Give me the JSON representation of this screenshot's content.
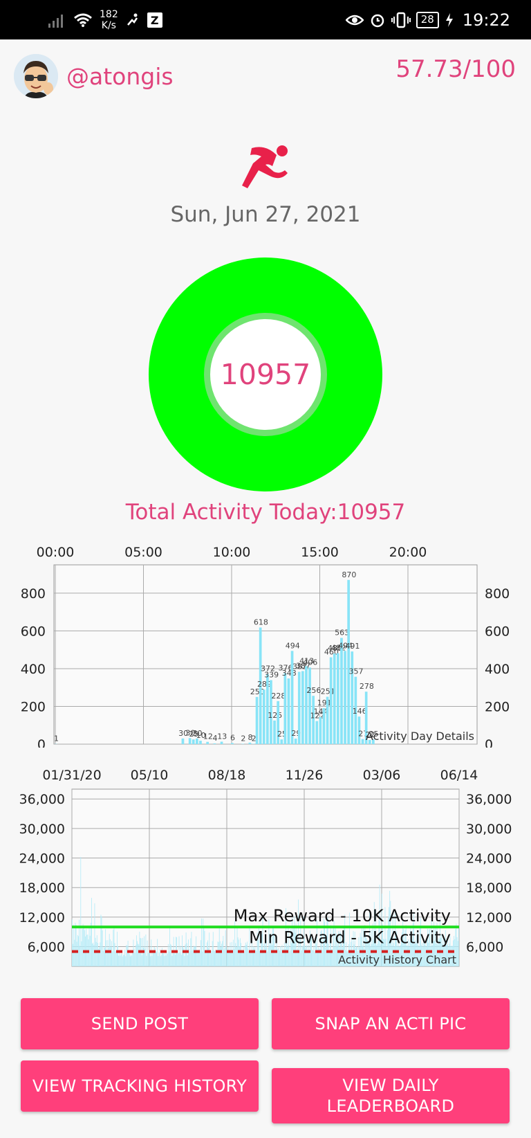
{
  "status_bar": {
    "speed_value": "182",
    "speed_unit": "K/s",
    "battery": "28",
    "time": "19:22"
  },
  "header": {
    "username": "@atongis",
    "score": "57.73/100"
  },
  "date": "Sun, Jun 27, 2021",
  "activity_ring": {
    "value": "10957",
    "progress": 1.0,
    "ring_color": "#00ff00",
    "inner_color": "#6fe46f"
  },
  "total_activity": "Total Activity Today:10957",
  "colors": {
    "accent": "#e0437c",
    "button": "#ff3f7b",
    "bar": "#88e4f7",
    "max_line": "#22dd22",
    "min_line": "#d42020"
  },
  "chart_data": [
    {
      "type": "bar",
      "caption": "Activity Day Details",
      "x_ticks": [
        "00:00",
        "05:00",
        "10:00",
        "15:00",
        "20:00"
      ],
      "ylim": [
        0,
        950
      ],
      "y_ticks": [
        "0",
        "200",
        "400",
        "600",
        "800"
      ],
      "values": [
        [
          0,
          1,
          "1"
        ],
        [
          36,
          30,
          "30"
        ],
        [
          38,
          32,
          "30"
        ],
        [
          39,
          25,
          "25"
        ],
        [
          40,
          30,
          "30"
        ],
        [
          41,
          18,
          "10"
        ],
        [
          43,
          12,
          "12"
        ],
        [
          45,
          4,
          "4"
        ],
        [
          47,
          13,
          "13"
        ],
        [
          50,
          6,
          "6"
        ],
        [
          53,
          2,
          "2"
        ],
        [
          55,
          8,
          "8"
        ],
        [
          56,
          2,
          "2"
        ],
        [
          57,
          250,
          "250"
        ],
        [
          58,
          618,
          "618"
        ],
        [
          59,
          289,
          "289"
        ],
        [
          60,
          372,
          "372"
        ],
        [
          61,
          339,
          "339"
        ],
        [
          62,
          125,
          "125"
        ],
        [
          63,
          228,
          "228"
        ],
        [
          64,
          25,
          "25"
        ],
        [
          65,
          376,
          "376"
        ],
        [
          66,
          348,
          "348"
        ],
        [
          67,
          494,
          "494"
        ],
        [
          68,
          29,
          "29"
        ],
        [
          69,
          383,
          "383"
        ],
        [
          70,
          387,
          "387"
        ],
        [
          71,
          413,
          "413"
        ],
        [
          72,
          406,
          "406"
        ],
        [
          73,
          256,
          "256"
        ],
        [
          74,
          122,
          "122"
        ],
        [
          75,
          144,
          "144"
        ],
        [
          76,
          191,
          "191"
        ],
        [
          77,
          251,
          "251"
        ],
        [
          78,
          460,
          "460"
        ],
        [
          79,
          480,
          "480"
        ],
        [
          80,
          482,
          "482"
        ],
        [
          81,
          563,
          "563"
        ],
        [
          82,
          494,
          "494"
        ],
        [
          83,
          870,
          "870"
        ],
        [
          84,
          491,
          "491"
        ],
        [
          85,
          357,
          "357"
        ],
        [
          86,
          146,
          "146"
        ],
        [
          87,
          27,
          "27"
        ],
        [
          88,
          278,
          "278"
        ],
        [
          89,
          22,
          "22"
        ],
        [
          90,
          25,
          "25"
        ]
      ]
    },
    {
      "type": "bar",
      "caption": "Activity History Chart",
      "x_ticks": [
        "01/31/20",
        "05/10",
        "08/18",
        "11/26",
        "03/06",
        "06/14"
      ],
      "ylim": [
        2000,
        38000
      ],
      "y_ticks": [
        "6,000",
        "12,000",
        "18,000",
        "24,000",
        "30,000",
        "36,000"
      ],
      "max_reward": {
        "label": "Max Reward - 10K Activity",
        "value": 10000
      },
      "min_reward": {
        "label": "Min Reward - 5K Activity",
        "value": 5000
      },
      "segments": [
        [
          0,
          30,
          6000,
          26000
        ],
        [
          30,
          60,
          5000,
          14000
        ],
        [
          60,
          150,
          4000,
          11000
        ],
        [
          150,
          270,
          5000,
          13000
        ],
        [
          270,
          380,
          5000,
          16000
        ],
        [
          380,
          420,
          6000,
          21000
        ],
        [
          420,
          500,
          6000,
          14000
        ]
      ]
    }
  ],
  "buttons": {
    "send_post": "SEND POST",
    "snap_pic": "SNAP AN ACTI PIC",
    "tracking_history": "VIEW TRACKING HISTORY",
    "daily_leaderboard": "VIEW DAILY LEADERBOARD"
  }
}
